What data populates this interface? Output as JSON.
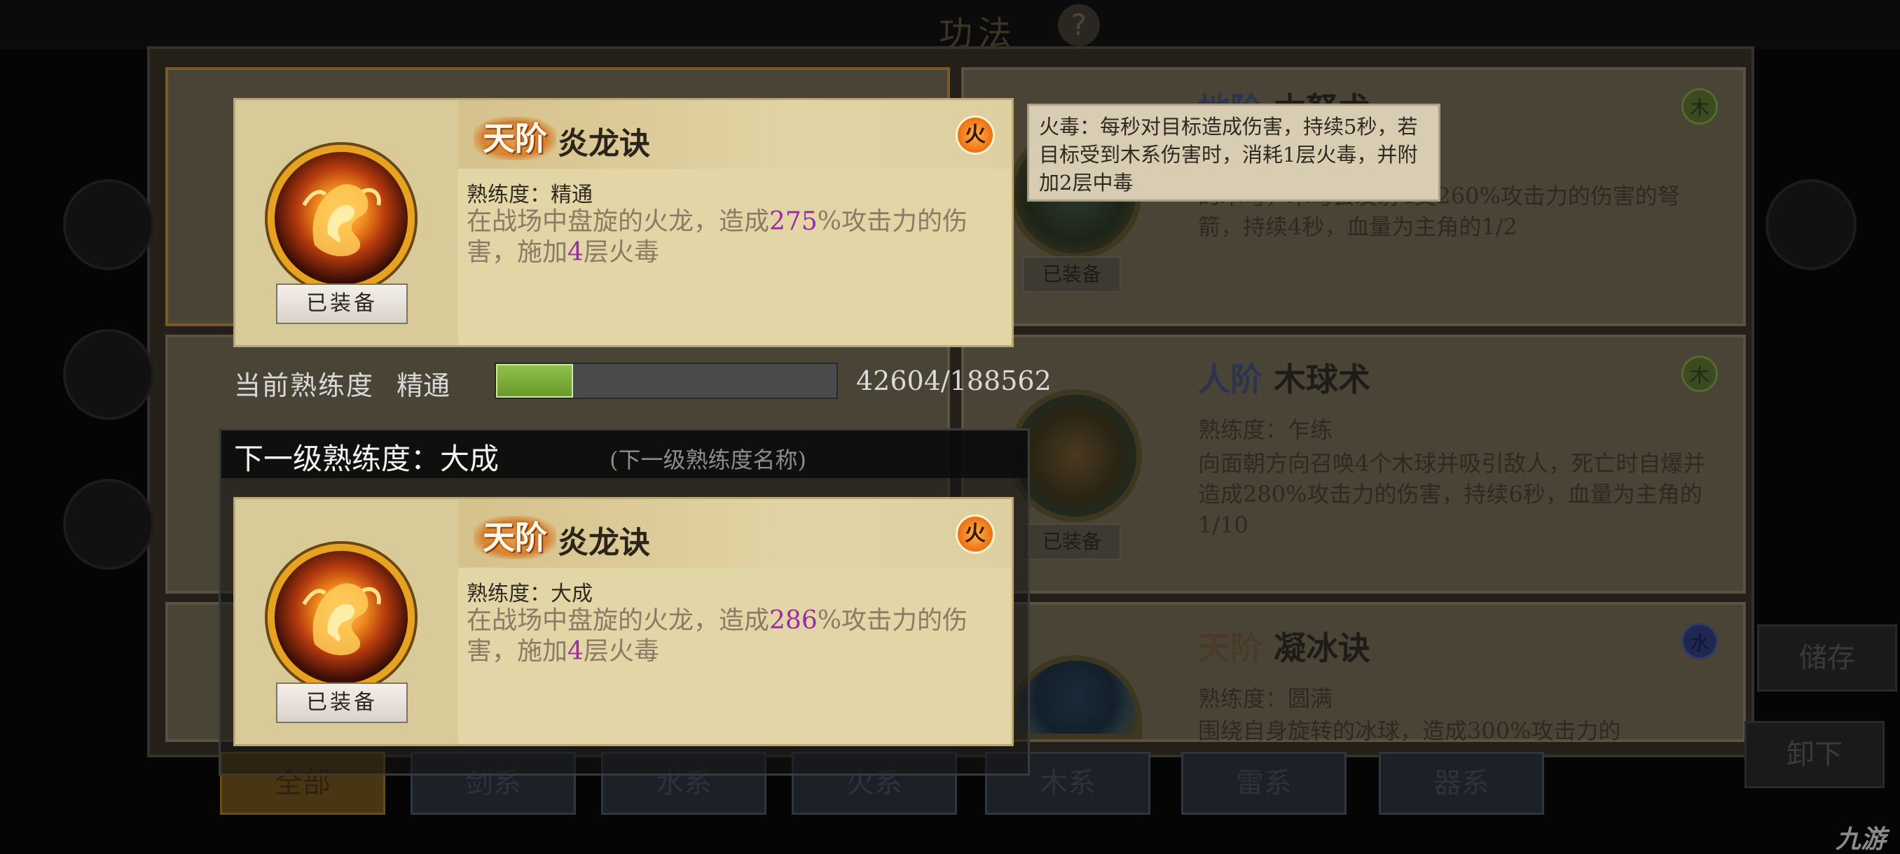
{
  "header": {
    "title": "功法",
    "help_icon": "?"
  },
  "background_cards": [
    {
      "tier": "地阶",
      "name": "木弩术",
      "element": "木",
      "text": "的木弩，木弩会发射4支260%攻击力的伤害的弩箭，持续4秒，血量为主角的1/2",
      "equip": "已装备"
    },
    {
      "tier": "人阶",
      "name": "木球术",
      "element": "木",
      "mastery": "熟练度：乍练",
      "text": "向面朝方向召唤4个木球并吸引敌人，死亡时自爆并造成280%攻击力的伤害，持续6秒，血量为主角的1/10",
      "equip": "已装备"
    },
    {
      "tier": "天阶",
      "name": "凝冰诀",
      "element": "水",
      "mastery": "熟练度：圆满",
      "text": "围绕自身旋转的冰球，造成300%攻击力的"
    }
  ],
  "tabs": [
    "全部",
    "剑系",
    "水系",
    "火系",
    "木系",
    "雷系",
    "器系"
  ],
  "side_buttons": [
    "储存",
    "卸下"
  ],
  "current_card": {
    "tier": "天阶",
    "name": "炎龙诀",
    "element": "火",
    "mastery": "熟练度：精通",
    "desc_parts": [
      "在战场中盘旋的火龙，造成",
      "275",
      "%攻击力的伤害，施加",
      "4",
      "层火毒"
    ],
    "equip": "已装备"
  },
  "progress": {
    "label": "当前熟练度",
    "level": "精通",
    "current": 42604,
    "max": 188562,
    "text": "42604/188562",
    "fill_fraction": 0.226
  },
  "next_level": {
    "label": "下一级熟练度：大成",
    "hint": "(下一级熟练度名称)"
  },
  "next_card": {
    "tier": "天阶",
    "name": "炎龙诀",
    "element": "火",
    "mastery": "熟练度：大成",
    "desc_parts": [
      "在战场中盘旋的火龙，造成",
      "286",
      "%攻击力的伤害，施加",
      "4",
      "层火毒"
    ],
    "equip": "已装备"
  },
  "tooltip": {
    "text": "火毒：每秒对目标造成伤害，持续5秒，若目标受到木系伤害时，消耗1层火毒，并附加2层中毒"
  },
  "watermark": "九游"
}
